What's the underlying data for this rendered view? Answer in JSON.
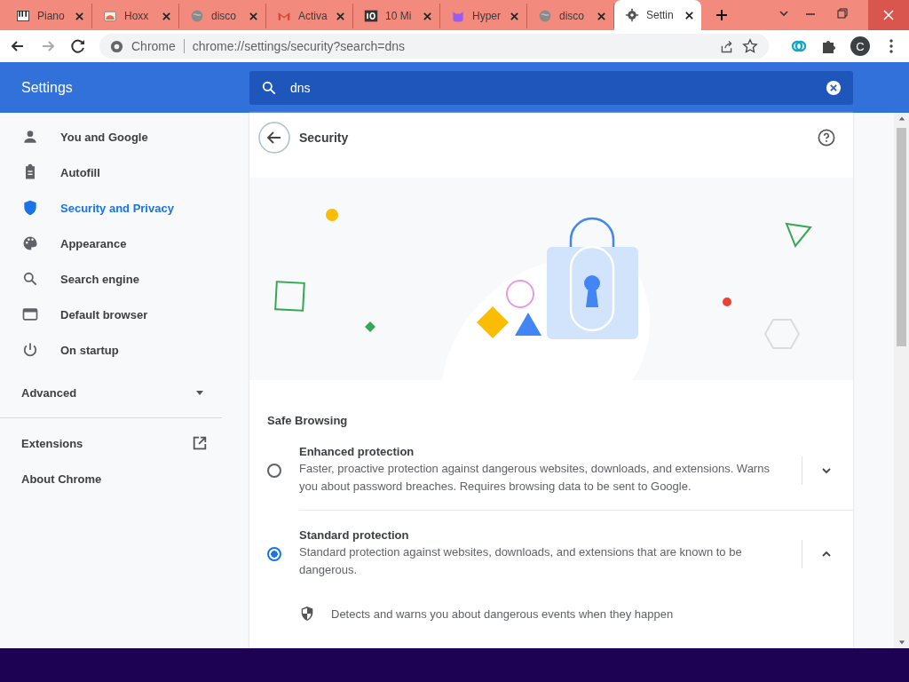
{
  "tabs": [
    {
      "title": "Piano",
      "selected": false
    },
    {
      "title": "Hoxx",
      "selected": false
    },
    {
      "title": "disco",
      "selected": false
    },
    {
      "title": "Activa",
      "selected": false
    },
    {
      "title": "10 Mi",
      "selected": false
    },
    {
      "title": "Hyper",
      "selected": false
    },
    {
      "title": "disco",
      "selected": false
    },
    {
      "title": "Settin",
      "selected": true
    }
  ],
  "toolbar": {
    "site": "Chrome",
    "url": "chrome://settings/security?search=dns",
    "avatar": "C"
  },
  "header": {
    "title": "Settings",
    "search": {
      "value": "dns"
    }
  },
  "sidebar": {
    "items": [
      {
        "label": "You and Google",
        "selected": false
      },
      {
        "label": "Autofill",
        "selected": false
      },
      {
        "label": "Security and Privacy",
        "selected": true
      },
      {
        "label": "Appearance",
        "selected": false
      },
      {
        "label": "Search engine",
        "selected": false
      },
      {
        "label": "Default browser",
        "selected": false
      },
      {
        "label": "On startup",
        "selected": false
      }
    ],
    "advanced": {
      "label": "Advanced",
      "expanded": false
    },
    "links": [
      {
        "label": "Extensions",
        "external": true
      },
      {
        "label": "About Chrome",
        "external": false
      }
    ]
  },
  "page": {
    "title": "Security",
    "section": "Safe Browsing",
    "options": [
      {
        "title": "Enhanced protection",
        "description": "Faster, proactive protection against dangerous websites, downloads, and extensions. Warns you about password breaches. Requires browsing data to be sent to Google.",
        "selected": false,
        "expanded": false
      },
      {
        "title": "Standard protection",
        "description": "Standard protection against websites, downloads, and extensions that are known to be dangerous.",
        "selected": true,
        "expanded": true
      }
    ],
    "details": [
      "Detects and warns you about dangerous events when they happen"
    ]
  }
}
